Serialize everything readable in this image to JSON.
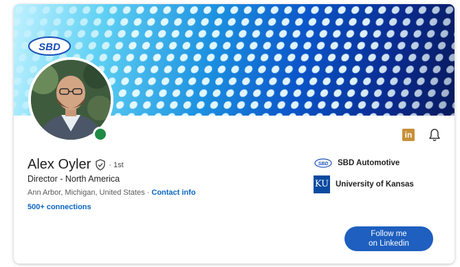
{
  "banner": {
    "logo_text": "SBD"
  },
  "profile": {
    "name": "Alex Oyler",
    "degree": "· 1st",
    "headline": "Director - North America",
    "location": "Ann Arbor, Michigan, United States · ",
    "contact_label": "Contact info",
    "connections": "500+ connections"
  },
  "icons": {
    "linkedin_glyph": "in",
    "verified": "shield-check-icon",
    "bell": "bell-icon"
  },
  "experience": {
    "company_logo_text": "SBD",
    "company_name": "SBD Automotive",
    "school_logo_text": "KU",
    "school_name": "University of Kansas"
  },
  "follow_button": {
    "line1": "Follow me",
    "line2": "on Linkedin"
  },
  "colors": {
    "link": "#0a66c2",
    "button": "#1e5fbf",
    "online": "#1e8a43",
    "linkedin_icon": "#c7913a"
  }
}
